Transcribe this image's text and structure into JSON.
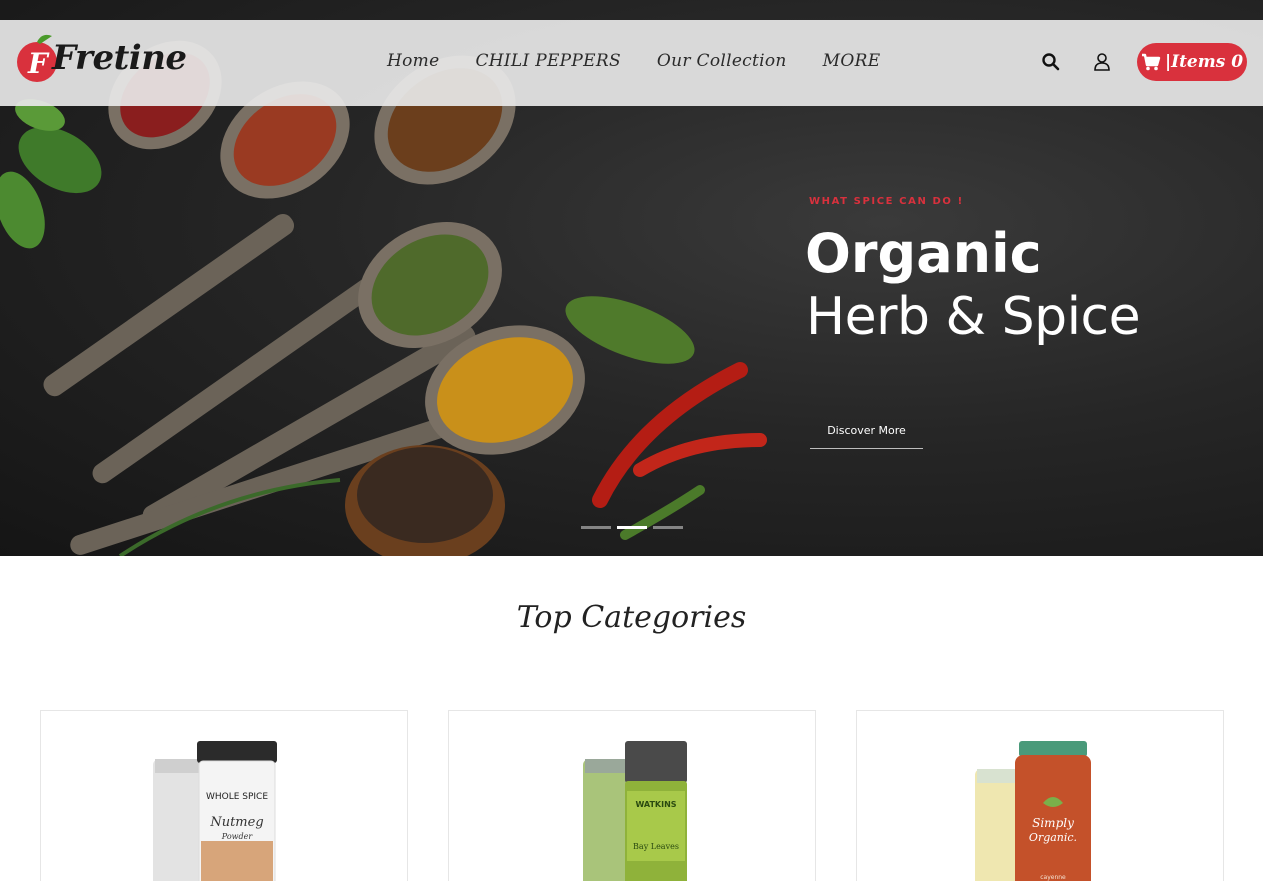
{
  "brand": {
    "name": "Fretine",
    "logo_letter": "F"
  },
  "nav": {
    "items": [
      "Home",
      "CHILI PEPPERS",
      "Our Collection",
      "MORE"
    ]
  },
  "header_icons": {
    "search": "search-icon",
    "account": "user-icon",
    "cart": "cart-icon"
  },
  "cart": {
    "label": "|Items 0"
  },
  "hero": {
    "eyebrow": "WHAT SPICE CAN DO !",
    "title": "Organic",
    "subtitle": "Herb & Spice",
    "cta": "Discover More",
    "slides_total": 3,
    "active_slide": 2
  },
  "categories": {
    "title": "Top Categories",
    "items": [
      {
        "jar_label_top": "WHOLE SPICE",
        "jar_label_main": "Nutmeg",
        "jar_label_sub": "Powder"
      },
      {
        "jar_label_top": "WATKINS",
        "jar_label_main": "Bay Leaves"
      },
      {
        "jar_label_top": "Simply",
        "jar_label_main": "Organic.",
        "jar_label_sub": "cayenne"
      }
    ]
  },
  "colors": {
    "accent": "#d9313d",
    "header_bg": "#e8e8e8",
    "hero_bg": "#262626"
  }
}
